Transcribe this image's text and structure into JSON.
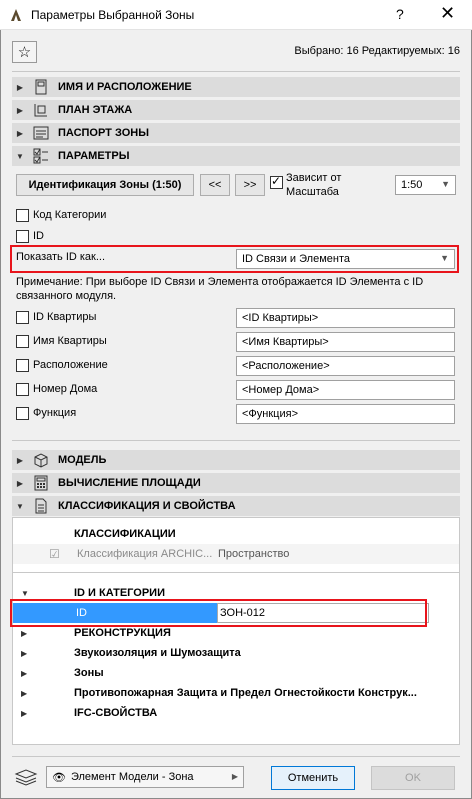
{
  "window": {
    "title": "Параметры Выбранной Зоны",
    "help": "?",
    "close": "✕"
  },
  "selection": "Выбрано: 16 Редактируемых: 16",
  "sections": [
    {
      "label": "ИМЯ И РАСПОЛОЖЕНИЕ",
      "expanded": false
    },
    {
      "label": "ПЛАН ЭТАЖА",
      "expanded": false
    },
    {
      "label": "ПАСПОРТ ЗОНЫ",
      "expanded": false
    },
    {
      "label": "ПАРАМЕТРЫ",
      "expanded": true
    },
    {
      "label": "МОДЕЛЬ",
      "expanded": false
    },
    {
      "label": "ВЫЧИСЛЕНИЕ ПЛОЩАДИ",
      "expanded": false
    },
    {
      "label": "КЛАССИФИКАЦИЯ И СВОЙСТВА",
      "expanded": true
    }
  ],
  "params": {
    "ident_button": "Идентификация Зоны (1:50)",
    "prev": "<<",
    "next": ">>",
    "depends_scale_line1": "Зависит от",
    "depends_scale_line2": "Масштаба",
    "scale_value": "1:50",
    "cat_code": "Код Категории",
    "id_label": "ID",
    "show_id_label": "Показать ID как...",
    "show_id_value": "ID Связи и Элемента",
    "note": "Примечание: При выборе ID Связи и Элемента отображается ID Элемента с ID связанного модуля.",
    "fields": [
      {
        "label": "ID Квартиры",
        "value": "<ID Квартиры>"
      },
      {
        "label": "Имя Квартиры",
        "value": "<Имя Квартиры>"
      },
      {
        "label": "Расположение",
        "value": "<Расположение>"
      },
      {
        "label": "Номер Дома",
        "value": "<Номер Дома>"
      },
      {
        "label": "Функция",
        "value": "<Функция>"
      }
    ]
  },
  "classification": {
    "header": "КЛАССИФИКАЦИИ",
    "row_label": "Классификация ARCHIC...",
    "row_value": "Пространство"
  },
  "tree": {
    "id_categories": "ID И КАТЕГОРИИ",
    "id_key": "ID",
    "id_value": "ЗОН-012",
    "groups": [
      "РЕКОНСТРУКЦИЯ",
      "Звукоизоляция и Шумозащита",
      "Зоны",
      "Противопожарная Защита и Предел Огнестойкости Конструк...",
      "IFC-СВОЙСТВА"
    ]
  },
  "bottom": {
    "layer_value": "Элемент Модели - Зона",
    "cancel": "Отменить",
    "ok": "OK"
  }
}
